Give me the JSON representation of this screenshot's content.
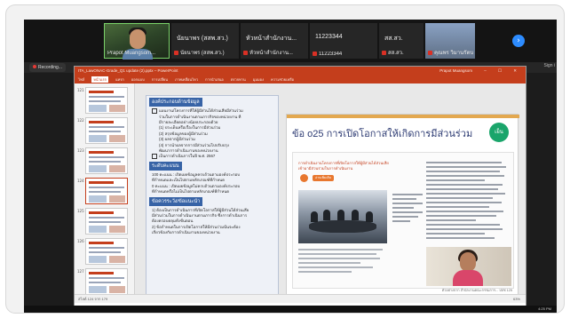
{
  "participants": [
    {
      "name": "Prapot Muangsom...",
      "kind": "video"
    },
    {
      "name": "นัยนาพร (สสพ.สว.)",
      "label": "นัยนาพร (สสพ.สว.)",
      "kind": "text"
    },
    {
      "name": "หัวหน้าสำนักงาน...",
      "label": "หัวหน้าสำนักงาน...",
      "kind": "text"
    },
    {
      "name": "11223344",
      "label": "11223344",
      "kind": "text"
    },
    {
      "name": "สส.สว.",
      "label": "สส.สว.",
      "kind": "text"
    },
    {
      "name": "คุณพร วิมานรัตน",
      "kind": "photo"
    }
  ],
  "share": {
    "recording_label": "Recording...",
    "signin_label": "Sign i"
  },
  "ppt": {
    "title": "ITA_LawONAC-Grade_Q1 update (2).pptx  –  PowerPoint",
    "user": "Prapot Muangsom",
    "window_buttons": "– ☐ ✕",
    "tabs": [
      "ไฟล์",
      "หน้าแรก",
      "แทรก",
      "ออกแบบ",
      "การเปลี่ยน",
      "ภาพเคลื่อนไหว",
      "การนำเสนอ",
      "ตรวจทาน",
      "มุมมอง",
      "ความช่วยเหลือ"
    ],
    "active_tab": 1,
    "thumb_numbers": [
      "121",
      "122",
      "123",
      "124",
      "125",
      "126",
      "127",
      "128"
    ],
    "status_left": "สไลด์ 124 จาก 179",
    "zoom": "63%"
  },
  "notes": {
    "section1": "องค์ประกอบด้านข้อมูล",
    "lines1": [
      "แผนงาน/โครงการที่ให้ผู้มีส่วนได้ส่วนเสียมีส่วนร่วม",
      "ร่วมในการดำเนินงานตามภารกิจของหน่วยงาน ที่",
      "มีรายละเอียดอย่างน้อยประกอบด้วย",
      "(1) ประเด็นหรือเรื่องในการมีส่วนร่วม",
      "(2) สรุปข้อมูลของผู้มีส่วนร่วม",
      "(3) ผลจากผู้มีส่วนร่วม",
      "(4) การนำผลจากการมีส่วนร่วมไปปรับปรุง",
      "พัฒนาการดำเนินงานของหน่วยงาน",
      "เป็นการดำเนินการในปี พ.ศ. 2567"
    ],
    "section2": "ระดับคะแนน",
    "lines2": [
      "100 คะแนน : เปิดเผยข้อมูลครบถ้วนตามองค์ประกอบ",
      "ที่กำหนดและเป็นไปตามหลักเกณฑ์ที่กำหนด",
      "0 คะแนน : เปิดเผยข้อมูลไม่ครบถ้วนตามองค์ประกอบ",
      "ที่กำหนดหรือไม่เป็นไปตามหลักเกณฑ์ที่กำหนด"
    ],
    "section3": "ข้อควรระวัง/ข้อแนะนำ",
    "lines3": [
      "1) ต้องเป็นการดำเนินการที่เปิดโอกาสให้ผู้มีส่วนได้ส่วนเสีย",
      "มีส่วนร่วมในการดำเนินงานตามภารกิจ ซึ่งการดำเนินการ",
      "ต้องครอบคลุมทั้งขั้นตอน",
      "2) ข้อกำหนดในการเปิดโอกาสให้มีส่วนร่วมนั้นจะต้อง",
      "เกี่ยวข้องกับการดำเนินงานของหน่วยงาน"
    ]
  },
  "slide": {
    "title": "ข้อ o25 การเปิดโอกาสให้เกิดการมีส่วนร่วม",
    "badge": "เย็น",
    "doc_head": "การดำเนินงานโครงการที่เปิดโอกาสให้ผู้มีส่วนได้ส่วนเสีย",
    "doc_head2": "เข้ามามีส่วนร่วมในการดำเนินงาน",
    "pill": "อ่านเพิ่มเติม",
    "footer": "ตัวอย่างจาก สำนักงานคณะกรรมการ... ปปช 125"
  },
  "taskbar": {
    "clock": "4:25 PM"
  }
}
